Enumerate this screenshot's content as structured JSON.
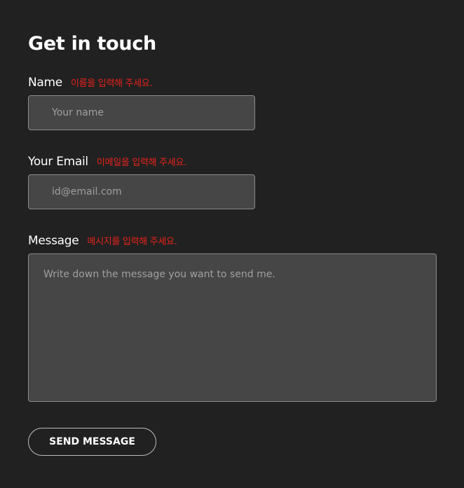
{
  "form": {
    "title": "Get in touch",
    "fields": {
      "name": {
        "label": "Name",
        "error": "이름을 입력해 주세요.",
        "value": "",
        "placeholder": "Your name"
      },
      "email": {
        "label": "Your Email",
        "error": "이메일을 입력해 주세요.",
        "value": "",
        "placeholder": "id@email.com"
      },
      "message": {
        "label": "Message",
        "error": "메시지를 입력해 주세요.",
        "value": "",
        "placeholder": "Write down the message you want to send me."
      }
    },
    "submit_label": "SEND MESSAGE"
  },
  "colors": {
    "background": "#212121",
    "input_background": "#464646",
    "input_border": "#8a8a8a",
    "error_text": "#e8221b",
    "text": "#ffffff",
    "placeholder": "#a0a0a0"
  }
}
